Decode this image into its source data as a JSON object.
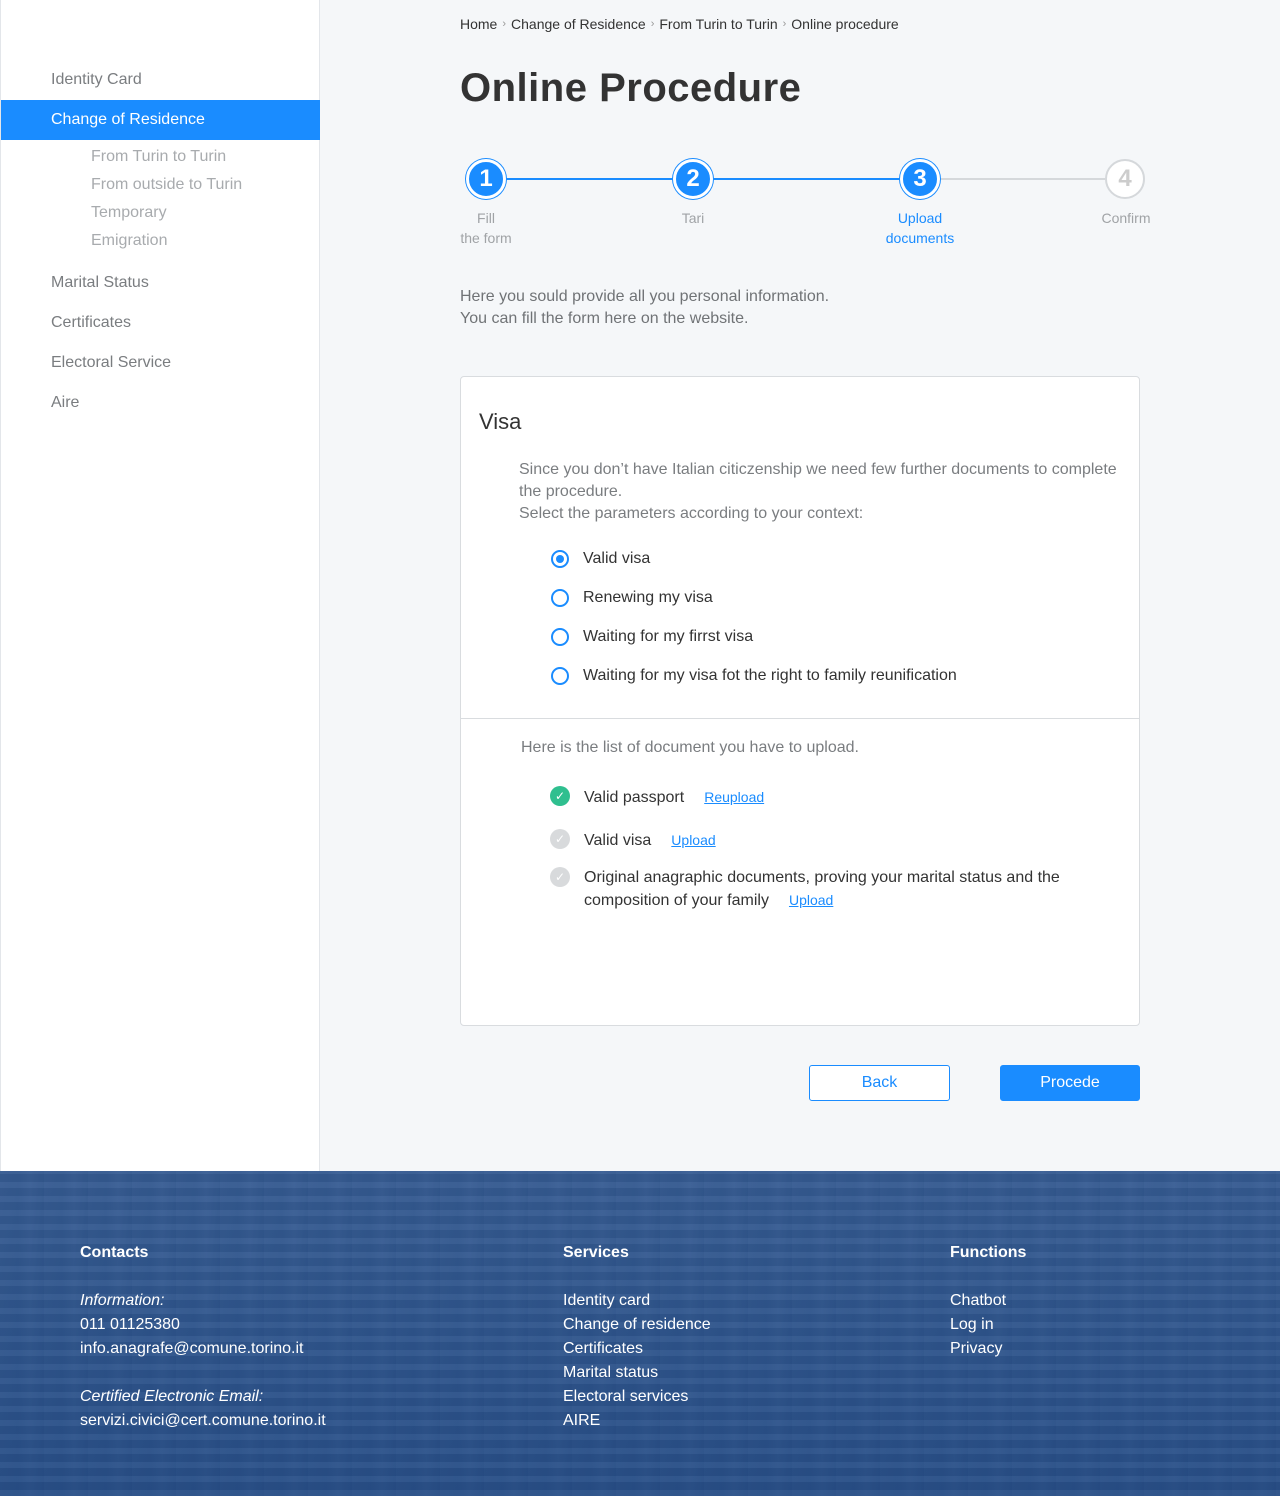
{
  "sidebar": {
    "items": [
      {
        "label": "Identity Card"
      },
      {
        "label": "Change of Residence"
      },
      {
        "label": "Marital Status"
      },
      {
        "label": "Certificates"
      },
      {
        "label": "Electoral Service"
      },
      {
        "label": "Aire"
      }
    ],
    "subitems": [
      {
        "label": "From Turin to Turin"
      },
      {
        "label": "From outside to Turin"
      },
      {
        "label": "Temporary"
      },
      {
        "label": "Emigration"
      }
    ]
  },
  "breadcrumb": [
    "Home",
    "Change of Residence",
    "From Turin to Turin",
    "Online procedure"
  ],
  "breadcrumb_separator": "›",
  "page_title": "Online Procedure",
  "stepper": {
    "steps": [
      {
        "number": "1",
        "label_line1": "Fill",
        "label_line2": "the form"
      },
      {
        "number": "2",
        "label_line1": "Tari",
        "label_line2": ""
      },
      {
        "number": "3",
        "label_line1": "Upload",
        "label_line2": "documents"
      },
      {
        "number": "4",
        "label_line1": "Confirm",
        "label_line2": ""
      }
    ],
    "current_step": 3
  },
  "intro": {
    "line1": "Here you sould provide all you personal information.",
    "line2": "You can fill the form here on the website."
  },
  "card": {
    "title": "Visa",
    "desc_line1": "Since you don’t have Italian citiczenship we need few further documents to complete the procedure.",
    "desc_line2": "Select the parameters according to your context:",
    "radios": [
      {
        "label": "Valid visa",
        "checked": true
      },
      {
        "label": "Renewing my visa",
        "checked": false
      },
      {
        "label": "Waiting for my firrst visa",
        "checked": false
      },
      {
        "label": "Waiting for my visa fot the right to family reunification",
        "checked": false
      }
    ],
    "docs_intro": "Here is the list of document you have to upload.",
    "docs": [
      {
        "label": "Valid passport",
        "action": "Reupload",
        "status": "uploaded"
      },
      {
        "label": "Valid visa",
        "action": "Upload",
        "status": "pending"
      },
      {
        "label": "Original anagraphic documents, proving your marital status and the composition of your family",
        "action": "Upload",
        "status": "pending"
      }
    ]
  },
  "buttons": {
    "back": "Back",
    "next": "Procede"
  },
  "footer": {
    "contacts": {
      "heading": "Contacts",
      "info_label": "Information:",
      "phone": "011 01125380",
      "email": "info.anagrafe@comune.torino.it",
      "cert_label": "Certified Electronic Email:",
      "cert_email": "servizi.civici@cert.comune.torino.it"
    },
    "services": {
      "heading": "Services",
      "items": [
        "Identity card",
        "Change of residence",
        "Certificates",
        "Marital status",
        "Electoral services",
        "AIRE"
      ]
    },
    "functions": {
      "heading": "Functions",
      "items": [
        "Chatbot",
        "Log in",
        "Privacy"
      ]
    }
  },
  "colors": {
    "accent": "#1a8cff",
    "success": "#2fbf8f",
    "footer": "#2a5590"
  }
}
